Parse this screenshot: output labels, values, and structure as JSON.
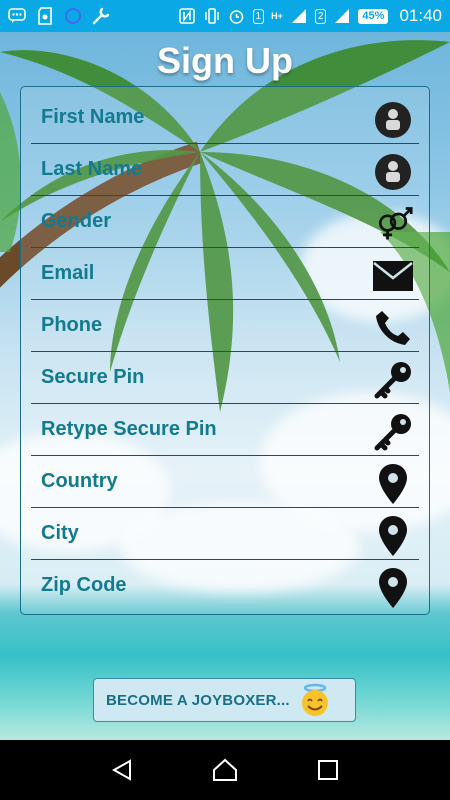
{
  "status_bar": {
    "sim1": "1",
    "sim2": "2",
    "network": "H+",
    "battery": "45%",
    "time": "01:40"
  },
  "page": {
    "title": "Sign Up"
  },
  "form": {
    "fields": [
      {
        "label": "First Name",
        "icon": "user-icon"
      },
      {
        "label": "Last Name",
        "icon": "user-icon"
      },
      {
        "label": "Gender",
        "icon": "gender-icon"
      },
      {
        "label": "Email",
        "icon": "mail-icon"
      },
      {
        "label": "Phone",
        "icon": "phone-icon"
      },
      {
        "label": "Secure Pin",
        "icon": "key-icon"
      },
      {
        "label": "Retype Secure Pin",
        "icon": "key-icon"
      },
      {
        "label": "Country",
        "icon": "map-pin-icon"
      },
      {
        "label": "City",
        "icon": "map-pin-icon"
      },
      {
        "label": "Zip Code",
        "icon": "map-pin-icon"
      }
    ]
  },
  "cta": {
    "label": "BECOME A JOYBOXER..."
  },
  "colors": {
    "status_bar": "#0aa9e6",
    "label_text": "#137a8f",
    "card_border": "#1a6f86"
  }
}
